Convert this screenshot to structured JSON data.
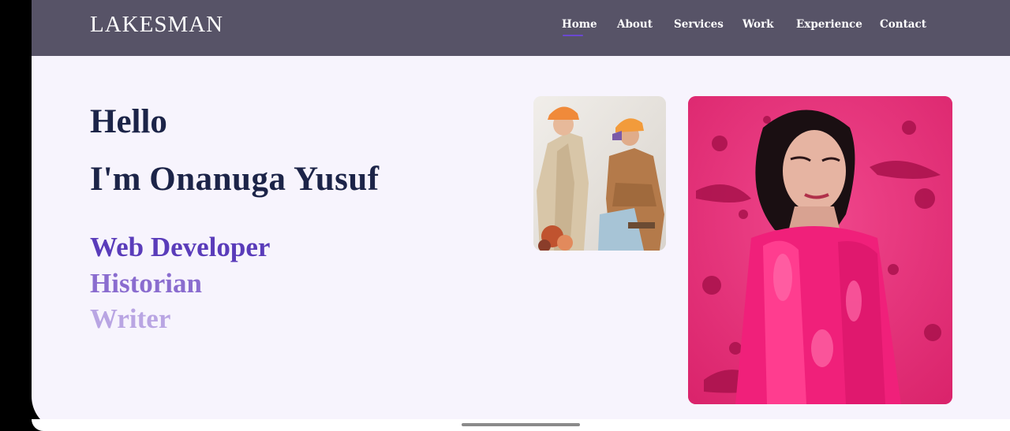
{
  "header": {
    "logo": "LAKESMAN",
    "nav": [
      {
        "label": "Home",
        "active": true
      },
      {
        "label": "About",
        "active": false
      },
      {
        "label": "Services",
        "active": false
      },
      {
        "label": "Work",
        "active": false
      },
      {
        "label": "Experience",
        "active": false
      },
      {
        "label": "Contact",
        "active": false
      }
    ]
  },
  "hero": {
    "greeting": "Hello",
    "intro_prefix": "I'm ",
    "name": "Onanuga Yusuf",
    "roles": [
      "Web Developer",
      "Historian",
      "Writer"
    ]
  },
  "images": {
    "small": "two people in coats and orange bucket hats",
    "large": "woman covered in pink paint on pink splatter background"
  },
  "colors": {
    "header_bg": "#575367",
    "page_bg": "#f7f4fd",
    "text_dark": "#1c2448",
    "accent": "#6b48d1",
    "role_colors": [
      "#5a3cba",
      "#8a6ccf",
      "#b9a5e3"
    ]
  }
}
